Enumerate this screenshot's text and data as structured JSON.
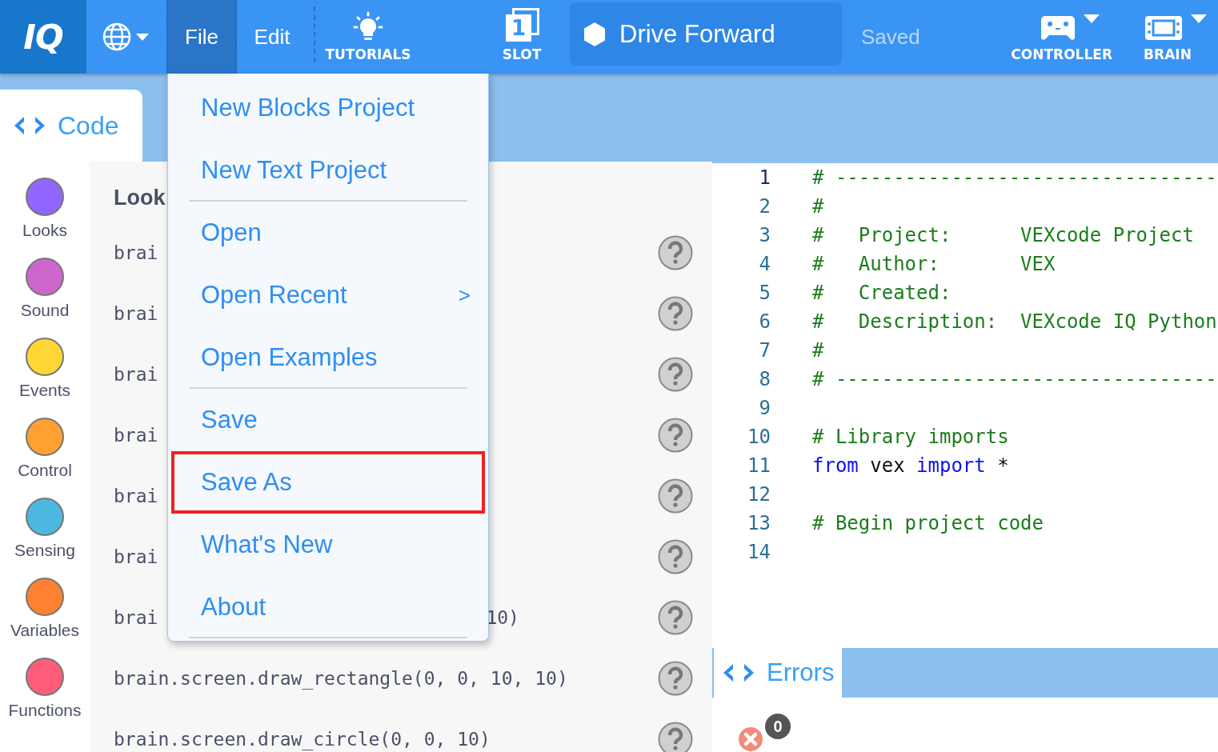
{
  "toolbar": {
    "logo": "IQ",
    "menus": [
      {
        "label": "File",
        "selected": true
      },
      {
        "label": "Edit",
        "selected": false
      }
    ],
    "tutorials": "TUTORIALS",
    "slot": {
      "number": "1",
      "label": "SLOT"
    },
    "project_name": "Drive Forward",
    "status": "Saved",
    "devices": [
      {
        "kind": "controller",
        "label": "CONTROLLER"
      },
      {
        "kind": "brain",
        "label": "BRAIN"
      }
    ]
  },
  "code_tab": "Code",
  "categories": [
    {
      "label": "Looks",
      "color": "#9166ff"
    },
    {
      "label": "Sound",
      "color": "#cc66cc"
    },
    {
      "label": "Events",
      "color": "#ffd633"
    },
    {
      "label": "Control",
      "color": "#ffa033"
    },
    {
      "label": "Sensing",
      "color": "#4cb8e0"
    },
    {
      "label": "Variables",
      "color": "#ff8030"
    },
    {
      "label": "Functions",
      "color": "#ff5c7a"
    }
  ],
  "snippets": {
    "heading": "Look",
    "rows": [
      {
        "text": "brai"
      },
      {
        "text": "brai"
      },
      {
        "text": "brai"
      },
      {
        "text": "brai"
      },
      {
        "text": "brai"
      },
      {
        "text": "brai"
      },
      {
        "text": "brai",
        "tail": "10)"
      },
      {
        "text": "brain.screen.draw_rectangle(0, 0, 10, 10)"
      },
      {
        "text": "brain.screen.draw_circle(0, 0, 10)"
      }
    ]
  },
  "file_menu": {
    "items": [
      {
        "kind": "item",
        "label": "New Blocks Project",
        "selected": false
      },
      {
        "kind": "item",
        "label": "New Text Project",
        "selected": false
      },
      {
        "kind": "divider"
      },
      {
        "kind": "item",
        "label": "Open",
        "selected": false
      },
      {
        "kind": "submenu",
        "label": "Open Recent",
        "arrow": ">",
        "selected": false
      },
      {
        "kind": "item",
        "label": "Open Examples",
        "selected": false
      },
      {
        "kind": "divider"
      },
      {
        "kind": "item",
        "label": "Save",
        "selected": false
      },
      {
        "kind": "item",
        "label": "Save As",
        "selected": true
      },
      {
        "kind": "item",
        "label": "What's New",
        "selected": false
      },
      {
        "kind": "item",
        "label": "About",
        "selected": false
      },
      {
        "kind": "divider"
      }
    ]
  },
  "editor": {
    "lines": [
      {
        "number": "1",
        "active": true,
        "parts": [
          {
            "kind": "comment",
            "text": "# ---------------------------------"
          }
        ]
      },
      {
        "number": "2",
        "active": false,
        "parts": [
          {
            "kind": "comment",
            "text": "#"
          }
        ]
      },
      {
        "number": "3",
        "active": false,
        "parts": [
          {
            "kind": "comment",
            "text": "#   Project:      VEXcode Project"
          }
        ]
      },
      {
        "number": "4",
        "active": false,
        "parts": [
          {
            "kind": "comment",
            "text": "#   Author:       VEX"
          }
        ]
      },
      {
        "number": "5",
        "active": false,
        "parts": [
          {
            "kind": "comment",
            "text": "#   Created:"
          }
        ]
      },
      {
        "number": "6",
        "active": false,
        "parts": [
          {
            "kind": "comment",
            "text": "#   Description:  VEXcode IQ Python"
          }
        ]
      },
      {
        "number": "7",
        "active": false,
        "parts": [
          {
            "kind": "comment",
            "text": "#"
          }
        ]
      },
      {
        "number": "8",
        "active": false,
        "parts": [
          {
            "kind": "comment",
            "text": "# ---------------------------------"
          }
        ]
      },
      {
        "number": "9",
        "active": false
      },
      {
        "number": "10",
        "active": false,
        "parts": [
          {
            "kind": "comment",
            "text": "# Library imports"
          }
        ]
      },
      {
        "number": "11",
        "active": false,
        "parts": [
          {
            "kind": "keyword",
            "text": "from"
          },
          {
            "kind": "plain",
            "text": "vex"
          },
          {
            "kind": "keyword",
            "text": "import"
          },
          {
            "kind": "plain",
            "text": "*"
          }
        ]
      },
      {
        "number": "12",
        "active": false
      },
      {
        "number": "13",
        "active": false,
        "parts": [
          {
            "kind": "comment",
            "text": "# Begin project code"
          }
        ]
      },
      {
        "number": "14",
        "active": false
      }
    ]
  },
  "errors": {
    "tab": "Errors",
    "count": "0"
  }
}
